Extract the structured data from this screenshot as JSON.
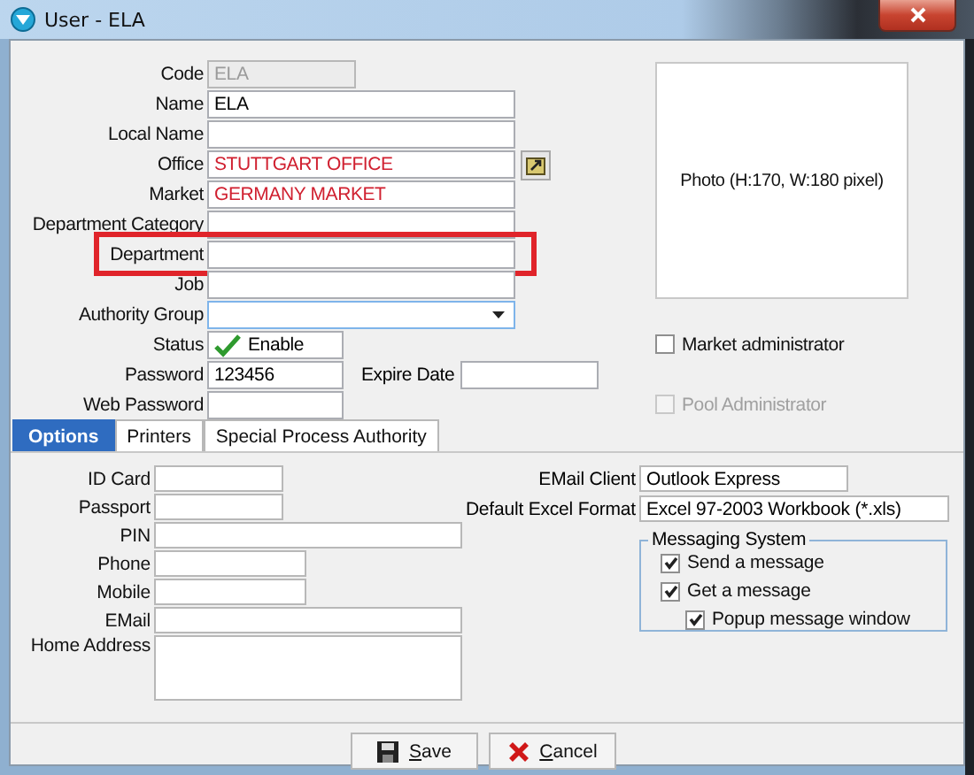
{
  "window": {
    "title": "User - ELA"
  },
  "fields": [
    {
      "label": "Code",
      "value": "ELA",
      "kind": "text",
      "disabled": true
    },
    {
      "label": "Name",
      "value": "ELA",
      "kind": "text",
      "disabled": false
    },
    {
      "label": "Local Name",
      "kind": "text",
      "disabled": false
    },
    {
      "label": "Office",
      "value": "STUTTGART OFFICE",
      "kind": "lookup",
      "disabled": false,
      "color": "#d02030"
    },
    {
      "label": "Market",
      "value": "GERMANY MARKET",
      "kind": "text",
      "disabled": false,
      "color": "#d02030"
    },
    {
      "label": "Department Category",
      "kind": "text",
      "disabled": false
    },
    {
      "label": "Department",
      "kind": "text",
      "disabled": false,
      "highlighted": true
    },
    {
      "label": "Job",
      "kind": "text",
      "disabled": false
    },
    {
      "label": "Authority Group",
      "kind": "dropdown",
      "disabled": false
    },
    {
      "label": "Status",
      "value": "Enable",
      "kind": "status",
      "disabled": false,
      "enabled": true
    },
    {
      "label": "Password",
      "value": "123456",
      "kind": "text",
      "disabled": false,
      "extra": {
        "label": "Expire Date"
      }
    },
    {
      "label": "Web Password",
      "kind": "text",
      "disabled": false
    }
  ],
  "photo": {
    "caption": "Photo (H:170, W:180 pixel)"
  },
  "admin_checkboxes": [
    {
      "label": "Market administrator",
      "checked": false,
      "disabled": false
    },
    {
      "label": "Pool Administrator",
      "checked": false,
      "disabled": true
    }
  ],
  "tabs": [
    {
      "label": "Options",
      "selected": true
    },
    {
      "label": "Printers",
      "selected": false
    },
    {
      "label": "Special Process Authority",
      "selected": false
    }
  ],
  "options": {
    "fields": [
      {
        "label": "ID Card",
        "kind": "text"
      },
      {
        "label": "Passport",
        "kind": "text"
      },
      {
        "label": "PIN",
        "kind": "text"
      },
      {
        "label": "Phone",
        "kind": "text"
      },
      {
        "label": "Mobile",
        "kind": "text"
      },
      {
        "label": "EMail",
        "kind": "text"
      },
      {
        "label": "Home Address",
        "kind": "textarea"
      }
    ],
    "email_client": {
      "label": "EMail Client",
      "value": "Outlook Express"
    },
    "excel_format": {
      "label": "Default Excel Format",
      "value": "Excel 97-2003 Workbook (*.xls)"
    },
    "messaging": {
      "title": "Messaging System",
      "items": [
        {
          "label": "Send a message",
          "checked": true
        },
        {
          "label": "Get a message",
          "checked": true,
          "children": [
            {
              "label": "Popup message window",
              "checked": true
            }
          ]
        }
      ]
    }
  },
  "buttons": [
    {
      "label": "Save",
      "kind": "save"
    },
    {
      "label": "Cancel",
      "kind": "cancel"
    }
  ]
}
